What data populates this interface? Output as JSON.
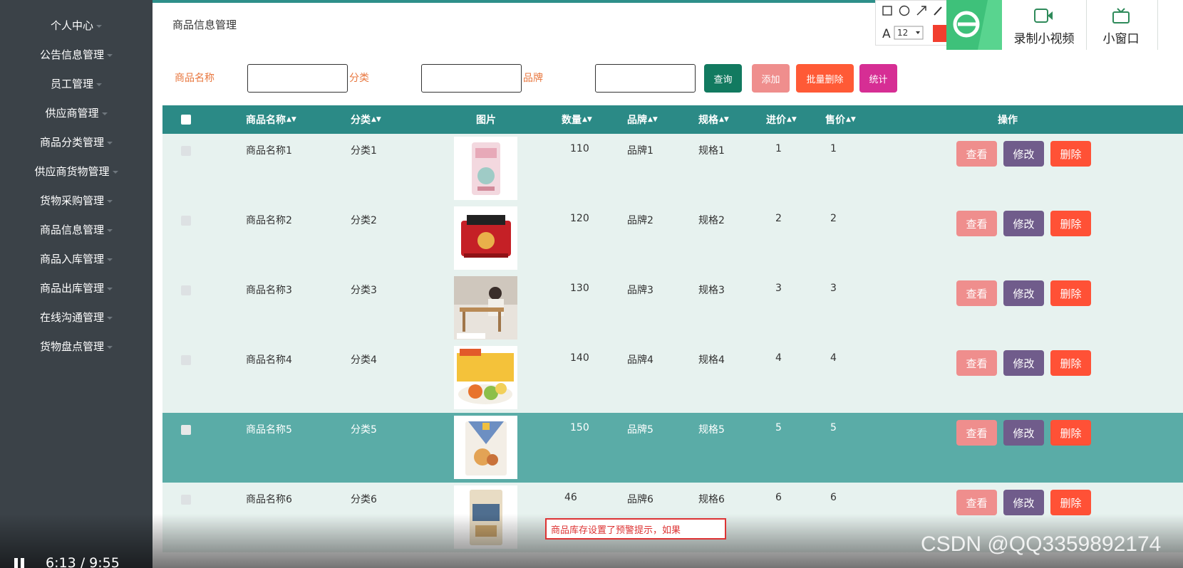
{
  "sidebar": {
    "items": [
      "个人中心",
      "公告信息管理",
      "员工管理",
      "供应商管理",
      "商品分类管理",
      "供应商货物管理",
      "货物采购管理",
      "商品信息管理",
      "商品入库管理",
      "商品出库管理",
      "在线沟通管理",
      "货物盘点管理"
    ]
  },
  "page": {
    "title": "商品信息管理"
  },
  "search": {
    "name_label": "商品名称",
    "category_label": "分类",
    "brand_label": "品牌",
    "name_value": "",
    "category_value": "",
    "brand_value": ""
  },
  "buttons": {
    "query": "查询",
    "add": "添加",
    "batch_delete": "批量删除",
    "stats": "统计"
  },
  "colors": {
    "query": "#127a60",
    "add": "#ef8e8d",
    "batch_delete": "#ff5a36",
    "stats": "#d62e94",
    "view": "#ef8e8d",
    "edit": "#705c8b",
    "delete": "#ff5136",
    "header": "#2b8a86"
  },
  "table": {
    "headers": {
      "name": "商品名称",
      "category": "分类",
      "image": "图片",
      "quantity": "数量",
      "brand": "品牌",
      "spec": "规格",
      "cost": "进价",
      "price": "售价",
      "actions": "操作"
    },
    "action_labels": {
      "view": "查看",
      "edit": "修改",
      "delete": "删除"
    },
    "rows": [
      {
        "name": "商品名称1",
        "category": "分类1",
        "quantity": "110",
        "brand": "品牌1",
        "spec": "规格1",
        "cost": "1",
        "price": "1"
      },
      {
        "name": "商品名称2",
        "category": "分类2",
        "quantity": "120",
        "brand": "品牌2",
        "spec": "规格2",
        "cost": "2",
        "price": "2"
      },
      {
        "name": "商品名称3",
        "category": "分类3",
        "quantity": "130",
        "brand": "品牌3",
        "spec": "规格3",
        "cost": "3",
        "price": "3"
      },
      {
        "name": "商品名称4",
        "category": "分类4",
        "quantity": "140",
        "brand": "品牌4",
        "spec": "规格4",
        "cost": "4",
        "price": "4"
      },
      {
        "name": "商品名称5",
        "category": "分类5",
        "quantity": "150",
        "brand": "品牌5",
        "spec": "规格5",
        "cost": "5",
        "price": "5"
      },
      {
        "name": "商品名称6",
        "category": "分类6",
        "quantity": "46",
        "brand": "品牌6",
        "spec": "规格6",
        "cost": "6",
        "price": "6"
      }
    ]
  },
  "overlay": {
    "annotation_text": "商品库存设置了预警提示，如果",
    "player_time": "6:13 / 9:55",
    "watermark": "CSDN @QQ3359892174",
    "recorder": {
      "record_label": "录制小视频",
      "mini_window_label": "小窗口",
      "font_size": "12"
    }
  }
}
